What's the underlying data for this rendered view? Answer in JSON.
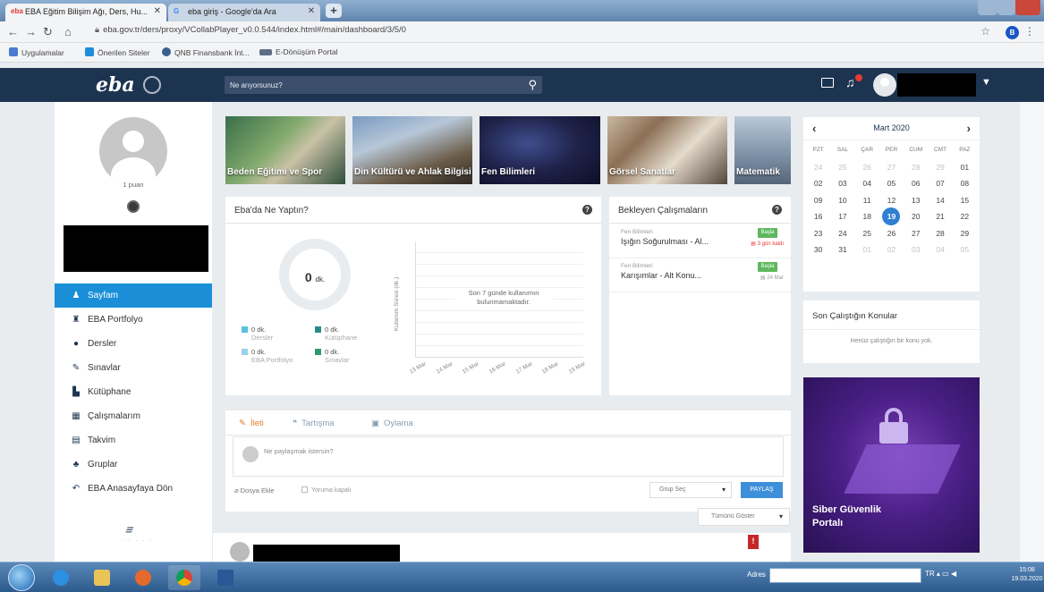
{
  "browser": {
    "tabs": [
      {
        "label": "EBA Eğitim Bilişim Ağı, Ders, Hu...",
        "active": true
      },
      {
        "label": "eba giriş - Google'da Ara",
        "active": false
      }
    ],
    "url": "eba.gov.tr/ders/proxy/VCollabPlayer_v0.0.544/index.html#/main/dashboard/3/5/0",
    "profile_initial": "B",
    "bookmarks": [
      "Uygulamalar",
      "Önerilen Siteler",
      "QNB Finansbank İnt...",
      "E-Dönüşüm Portal"
    ]
  },
  "nav": {
    "logo": "eba",
    "search_placeholder": "Ne arıyorsunuz?"
  },
  "profile": {
    "points": "1 puan"
  },
  "sidebar": {
    "items": [
      {
        "label": "Sayfam",
        "icon": "user-icon",
        "glyph": "♟",
        "active": true
      },
      {
        "label": "EBA Portfolyo",
        "icon": "portfolio-icon",
        "glyph": "♜",
        "active": false
      },
      {
        "label": "Dersler",
        "icon": "courses-icon",
        "glyph": "●",
        "active": false
      },
      {
        "label": "Sınavlar",
        "icon": "pencil-icon",
        "glyph": "✎",
        "active": false
      },
      {
        "label": "Kütüphane",
        "icon": "library-icon",
        "glyph": "▙",
        "active": false
      },
      {
        "label": "Çalışmalarım",
        "icon": "assignments-icon",
        "glyph": "▦",
        "active": false
      },
      {
        "label": "Takvim",
        "icon": "calendar-icon",
        "glyph": "▤",
        "active": false
      },
      {
        "label": "Gruplar",
        "icon": "groups-icon",
        "glyph": "♣",
        "active": false
      },
      {
        "label": "EBA Anasayfaya Dön",
        "icon": "back-icon",
        "glyph": "↶",
        "active": false
      }
    ]
  },
  "courses": [
    {
      "label": "Beden Eğitimi ve Spor"
    },
    {
      "label": "Din Kültürü ve Ahlak Bilgisi"
    },
    {
      "label": "Fen Bilimleri"
    },
    {
      "label": "Görsel Sanatlar"
    },
    {
      "label": "Matematik"
    }
  ],
  "activity": {
    "title": "Eba'da Ne Yaptın?",
    "total_value": "0",
    "total_unit": "dk.",
    "legend": [
      {
        "value": "0 dk.",
        "label": "Dersler",
        "color": "#5bc0de"
      },
      {
        "value": "0 dk.",
        "label": "Kütüphane",
        "color": "#2a8a8a"
      },
      {
        "value": "0 dk.",
        "label": "EBA Portfolyo",
        "color": "#9ad0ec"
      },
      {
        "value": "0 dk.",
        "label": "Sınavlar",
        "color": "#2e9a6a"
      }
    ],
    "chart_ylabel": "Kullanım Süresi (dk.)",
    "chart_message": "Son 7 günde kullanımın bulunmamaktadır.",
    "chart_dates": [
      "13 Mar",
      "14 Mar",
      "15 Mar",
      "16 Mar",
      "17 Mar",
      "18 Mar",
      "19 Mar"
    ]
  },
  "pending": {
    "title": "Bekleyen Çalışmaların",
    "items": [
      {
        "subject": "Fen Bilimleri",
        "title": "Işığın Soğurulması - Al...",
        "button": "Başla",
        "date": "3 gün kaldı",
        "late": true
      },
      {
        "subject": "Fen Bilimleri",
        "title": "Karışımlar - Alt Konu...",
        "button": "Başla",
        "date": "24 Mar",
        "late": false
      }
    ]
  },
  "composer": {
    "tabs": [
      {
        "label": "İleti",
        "icon": "edit-icon",
        "glyph": "✎",
        "active": true
      },
      {
        "label": "Tartışma",
        "icon": "chat-icon",
        "glyph": "❝",
        "active": false
      },
      {
        "label": "Oylama",
        "icon": "poll-icon",
        "glyph": "▣",
        "active": false
      }
    ],
    "placeholder": "Ne paylaşmak istersin?",
    "attach_label": "Dosya Ekle",
    "comments_off_label": "Yoruma kapalı",
    "group_select": "Grup Seç",
    "share_button": "PAYLAŞ",
    "show_all": "Tümünü Göster"
  },
  "calendar": {
    "month_label": "Mart 2020",
    "weekdays": [
      "PZT",
      "SAL",
      "ÇAR",
      "PER",
      "CUM",
      "CMT",
      "PAZ"
    ],
    "weeks": [
      [
        {
          "d": "24",
          "dim": true
        },
        {
          "d": "25",
          "dim": true
        },
        {
          "d": "26",
          "dim": true
        },
        {
          "d": "27",
          "dim": true
        },
        {
          "d": "28",
          "dim": true
        },
        {
          "d": "29",
          "dim": true
        },
        {
          "d": "01"
        }
      ],
      [
        {
          "d": "02"
        },
        {
          "d": "03"
        },
        {
          "d": "04"
        },
        {
          "d": "05"
        },
        {
          "d": "06"
        },
        {
          "d": "07"
        },
        {
          "d": "08"
        }
      ],
      [
        {
          "d": "09"
        },
        {
          "d": "10"
        },
        {
          "d": "11"
        },
        {
          "d": "12"
        },
        {
          "d": "13"
        },
        {
          "d": "14"
        },
        {
          "d": "15"
        }
      ],
      [
        {
          "d": "16"
        },
        {
          "d": "17"
        },
        {
          "d": "18"
        },
        {
          "d": "19",
          "today": true
        },
        {
          "d": "20"
        },
        {
          "d": "21"
        },
        {
          "d": "22"
        }
      ],
      [
        {
          "d": "23"
        },
        {
          "d": "24"
        },
        {
          "d": "25"
        },
        {
          "d": "26"
        },
        {
          "d": "27"
        },
        {
          "d": "28"
        },
        {
          "d": "29"
        }
      ],
      [
        {
          "d": "30"
        },
        {
          "d": "31"
        },
        {
          "d": "01",
          "dim": true
        },
        {
          "d": "02",
          "dim": true
        },
        {
          "d": "03",
          "dim": true
        },
        {
          "d": "04",
          "dim": true
        },
        {
          "d": "05",
          "dim": true
        }
      ]
    ]
  },
  "recent_topics": {
    "title": "Son Çalıştığın Konular",
    "empty": "Henüz çalıştığın bir konu yok."
  },
  "banner": {
    "title": "Siber Güvenlik Portalı"
  },
  "taskbar": {
    "address_label": "Adres",
    "tray_lang": "TR",
    "time": "15:08",
    "date": "19.03.2020"
  }
}
